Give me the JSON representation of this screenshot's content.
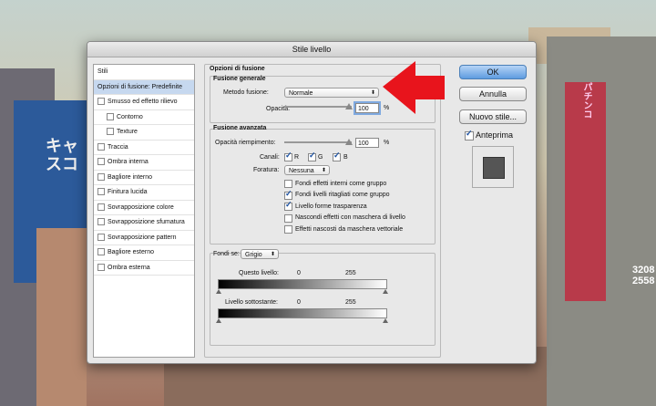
{
  "window": {
    "title": "Stile livello"
  },
  "background_signs": {
    "left": "キャスコ",
    "right": "パチンコ",
    "number": "3208\n2558"
  },
  "styles_list": {
    "items": [
      {
        "label": "Stili",
        "checkbox": false,
        "indent": false,
        "selected": false
      },
      {
        "label": "Opzioni di fusione: Predefinite",
        "checkbox": false,
        "indent": false,
        "selected": true
      },
      {
        "label": "Smusso ed effetto rilievo",
        "checkbox": true,
        "indent": false,
        "selected": false
      },
      {
        "label": "Contorno",
        "checkbox": true,
        "indent": true,
        "selected": false
      },
      {
        "label": "Texture",
        "checkbox": true,
        "indent": true,
        "selected": false
      },
      {
        "label": "Traccia",
        "checkbox": true,
        "indent": false,
        "selected": false
      },
      {
        "label": "Ombra interna",
        "checkbox": true,
        "indent": false,
        "selected": false
      },
      {
        "label": "Bagliore interno",
        "checkbox": true,
        "indent": false,
        "selected": false
      },
      {
        "label": "Finitura lucida",
        "checkbox": true,
        "indent": false,
        "selected": false
      },
      {
        "label": "Sovrapposizione colore",
        "checkbox": true,
        "indent": false,
        "selected": false
      },
      {
        "label": "Sovrapposizione sfumatura",
        "checkbox": true,
        "indent": false,
        "selected": false
      },
      {
        "label": "Sovrapposizione pattern",
        "checkbox": true,
        "indent": false,
        "selected": false
      },
      {
        "label": "Bagliore esterno",
        "checkbox": true,
        "indent": false,
        "selected": false
      },
      {
        "label": "Ombra esterna",
        "checkbox": true,
        "indent": false,
        "selected": false
      }
    ]
  },
  "blending": {
    "section_title": "Opzioni di fusione",
    "general": {
      "title": "Fusione generale",
      "mode_label": "Metodo fusione:",
      "mode_value": "Normale",
      "opacity_label": "Opacità:",
      "opacity_value": "100",
      "opacity_unit": "%"
    },
    "advanced": {
      "title": "Fusione avanzata",
      "fill_label": "Opacità riempimento:",
      "fill_value": "100",
      "fill_unit": "%",
      "channels_label": "Canali:",
      "channels": [
        {
          "label": "R",
          "checked": true
        },
        {
          "label": "G",
          "checked": true
        },
        {
          "label": "B",
          "checked": true
        }
      ],
      "knockout_label": "Foratura:",
      "knockout_value": "Nessuna",
      "options": [
        {
          "label": "Fondi effetti interni come gruppo",
          "checked": false
        },
        {
          "label": "Fondi livelli ritagliati come gruppo",
          "checked": true
        },
        {
          "label": "Livello forme trasparenza",
          "checked": true
        },
        {
          "label": "Nascondi effetti con maschera di livello",
          "checked": false
        },
        {
          "label": "Effetti nascosti da maschera vettoriale",
          "checked": false
        }
      ]
    },
    "blend_if": {
      "label": "Fondi se:",
      "value": "Grigio",
      "this_layer_label": "Questo livello:",
      "this_layer_min": "0",
      "this_layer_max": "255",
      "underlying_label": "Livello sottostante:",
      "underlying_min": "0",
      "underlying_max": "255"
    }
  },
  "buttons": {
    "ok": "OK",
    "cancel": "Annulla",
    "new_style": "Nuovo stile...",
    "preview_label": "Anteprima",
    "preview_checked": true
  },
  "annotation": {
    "arrow_color": "#e8141c"
  }
}
